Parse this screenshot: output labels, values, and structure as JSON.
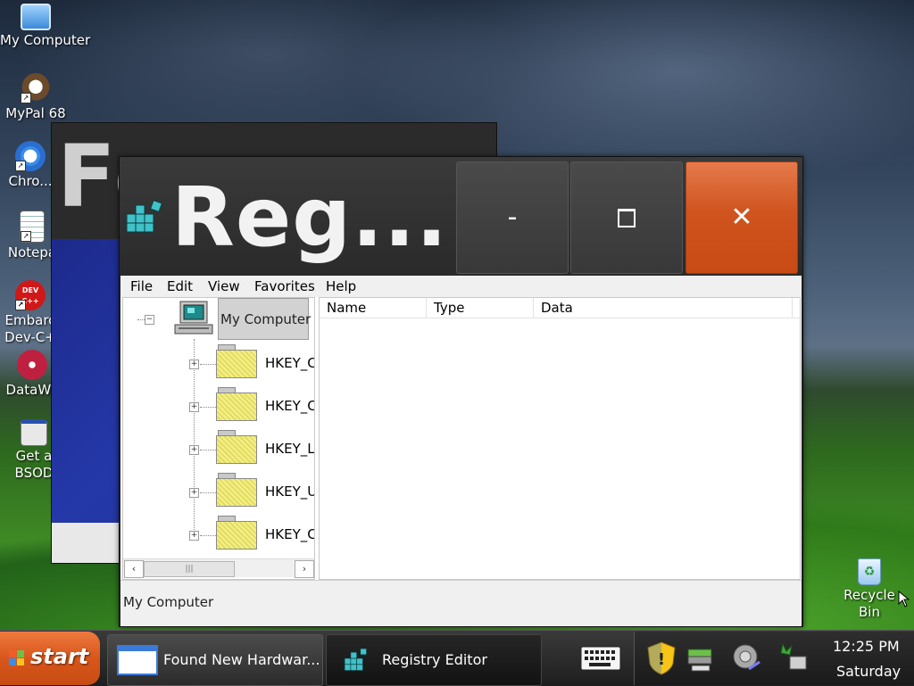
{
  "desktop": {
    "icons": [
      {
        "label": "My Computer",
        "icon": "my-computer-icon"
      },
      {
        "label": "MyPal 68",
        "icon": "mypal-icon"
      },
      {
        "label": "Chro...",
        "icon": "chrome-icon"
      },
      {
        "label": "Notepa",
        "icon": "notepad-icon"
      },
      {
        "label": "Embarc",
        "label2": "Dev-C+",
        "badge": "DEV C++",
        "icon": "devcpp-icon"
      },
      {
        "label": "DataWa",
        "icon": "datawa-icon"
      },
      {
        "label": "Get a",
        "label2": "BSOD",
        "icon": "bsod-icon"
      },
      {
        "label": "Recycle",
        "label2": "Bin",
        "icon": "recycle-bin-icon"
      }
    ]
  },
  "background_window": {
    "title": "Fo"
  },
  "registry_window": {
    "title": "Reg...",
    "caption": {
      "minimize": "-",
      "close": "✕"
    },
    "menu": [
      "File",
      "Edit",
      "View",
      "Favorites",
      "Help"
    ],
    "tree": {
      "root": "My Computer",
      "keys": [
        "HKEY_C",
        "HKEY_C",
        "HKEY_L",
        "HKEY_U",
        "HKEY_C"
      ]
    },
    "columns": [
      "Name",
      "Type",
      "Data"
    ],
    "status": "My Computer"
  },
  "taskbar": {
    "start_label": "start",
    "tasks": [
      {
        "label": "Found New Hardwar...",
        "icon": "window-icon"
      },
      {
        "label": "Registry Editor",
        "icon": "registry-icon"
      }
    ],
    "clock": {
      "time": "12:25 PM",
      "day": "Saturday"
    }
  },
  "colors": {
    "accent": "#d9561b",
    "title_bar": "#2b2b2b",
    "close_button": "#d0541f"
  }
}
